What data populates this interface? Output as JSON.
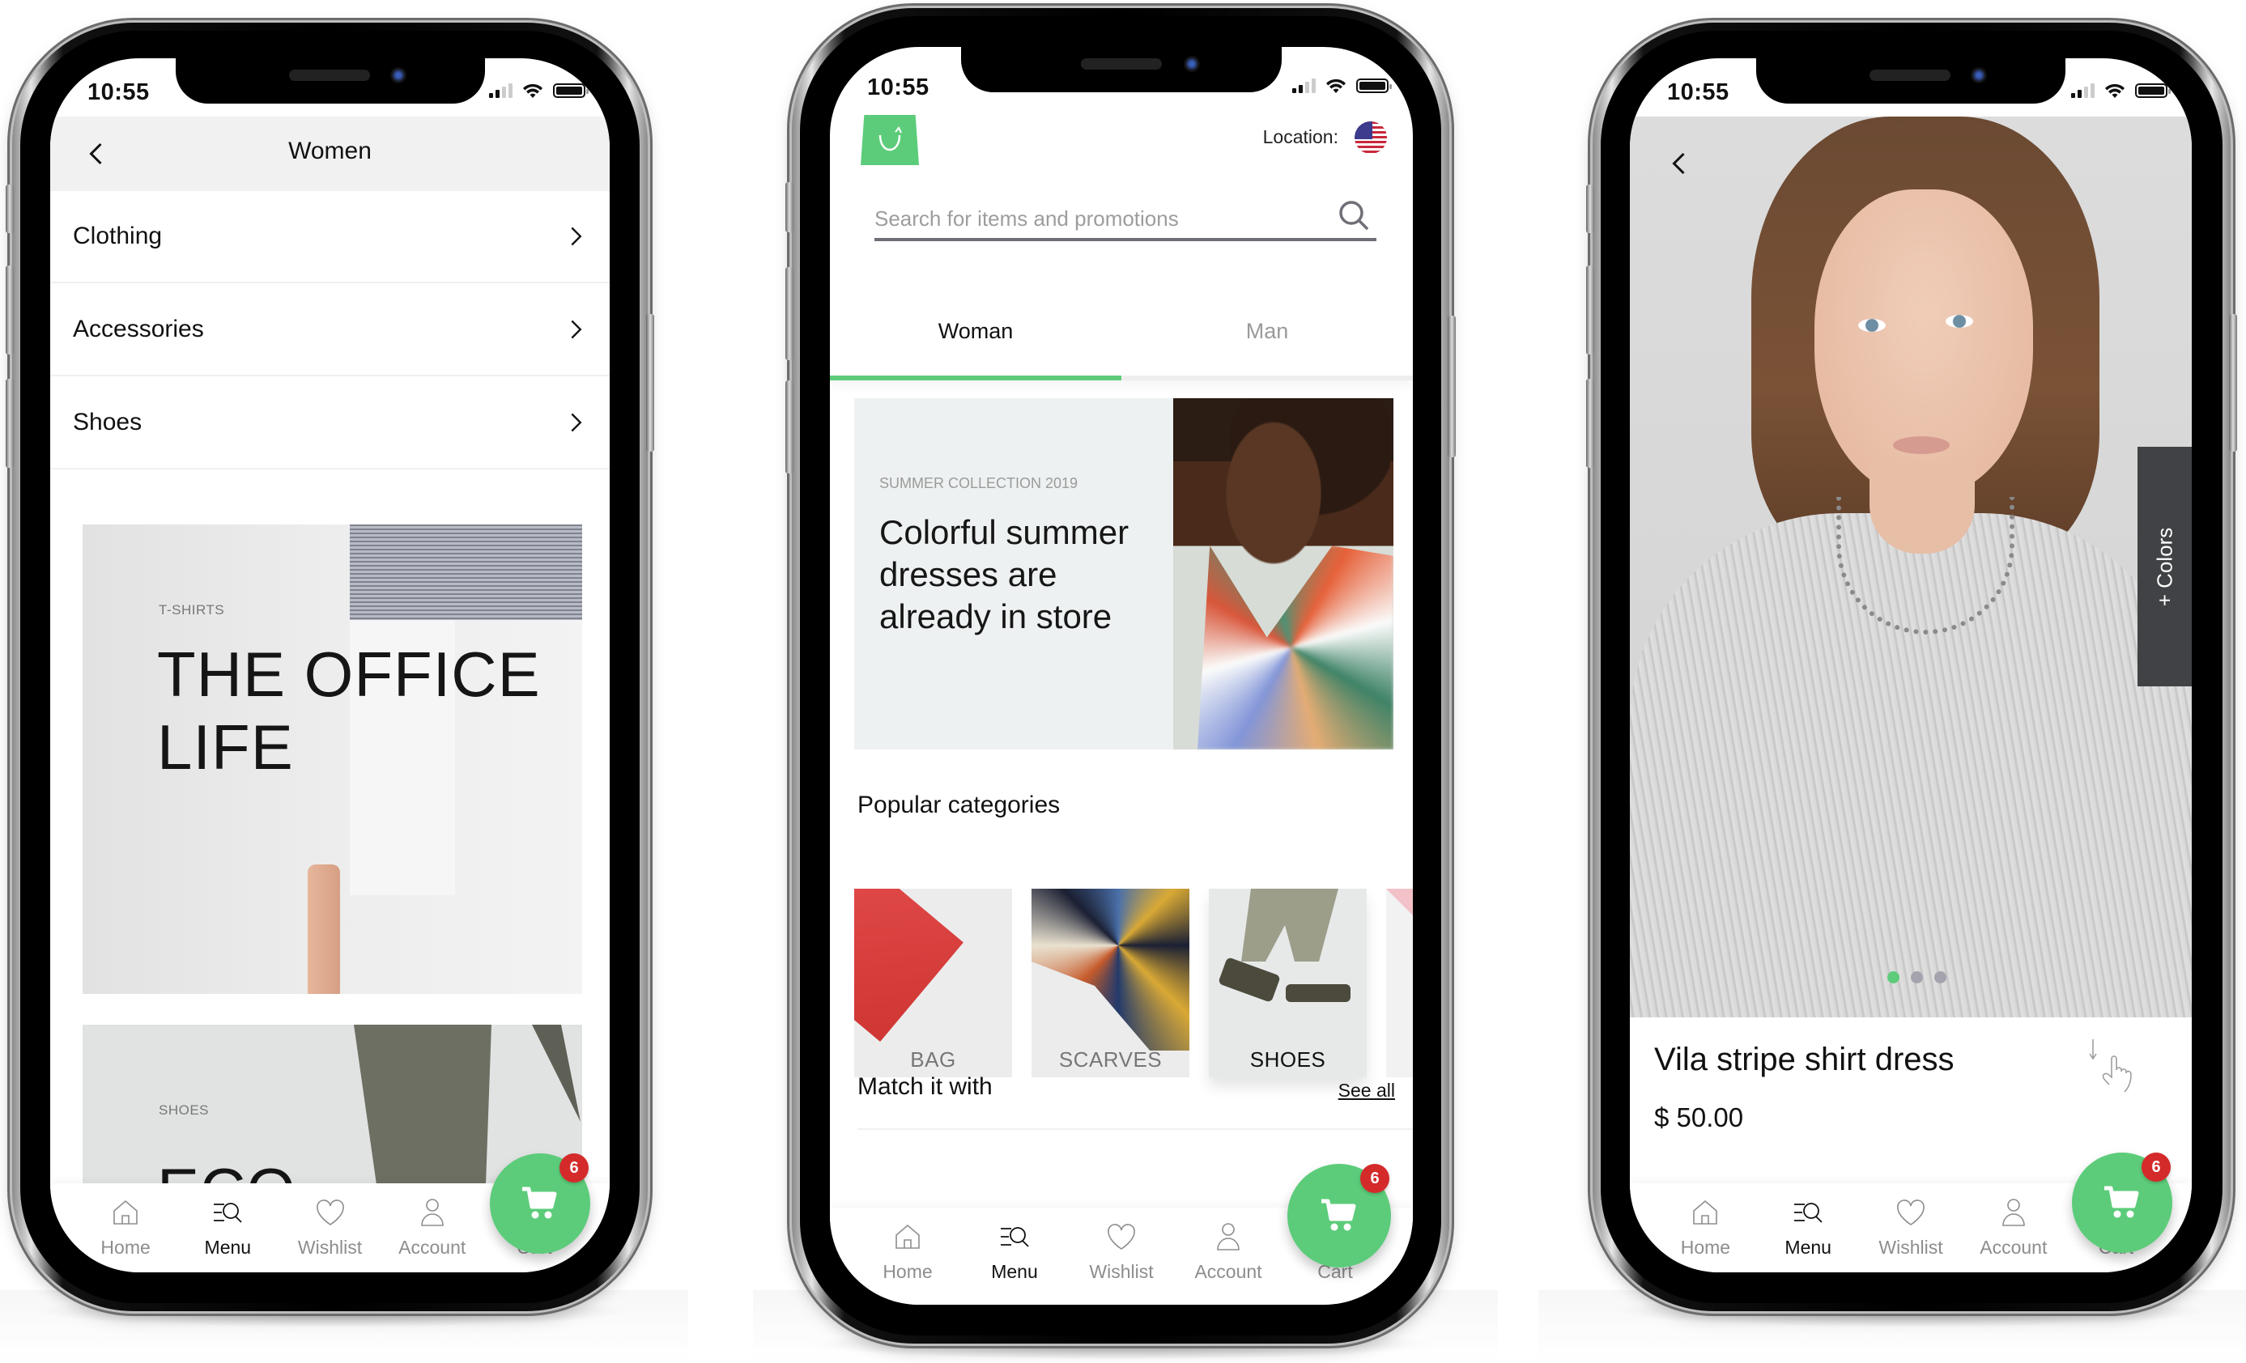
{
  "theme": {
    "accent": "#5ccc7a",
    "badge": "#d42a2a",
    "text": "#111111",
    "muted": "#8d8d8d",
    "colors_tab_bg": "#404245"
  },
  "status_bar": {
    "time": "10:55",
    "icons": [
      "signal-icon",
      "wifi-icon",
      "battery-icon"
    ]
  },
  "tabbar": {
    "items": [
      {
        "label": "Home",
        "icon": "home-icon"
      },
      {
        "label": "Menu",
        "icon": "menu-search-icon",
        "active": true
      },
      {
        "label": "Wishlist",
        "icon": "heart-icon"
      },
      {
        "label": "Account",
        "icon": "user-icon"
      },
      {
        "label": "Cart",
        "icon": "cart-icon"
      }
    ],
    "cart_count": "6"
  },
  "phone1": {
    "header": {
      "title": "Women",
      "back_icon": "chevron-left-icon"
    },
    "menu": [
      {
        "label": "Clothing",
        "icon": "chevron-right-icon"
      },
      {
        "label": "Accessories",
        "icon": "chevron-right-icon"
      },
      {
        "label": "Shoes",
        "icon": "chevron-right-icon"
      }
    ],
    "promos": [
      {
        "kicker": "T-SHIRTS",
        "title_line1": "THE OFFICE",
        "title_line2": "LIFE"
      },
      {
        "kicker": "SHOES",
        "title_line1": "ECO"
      }
    ]
  },
  "phone2": {
    "logo_icon": "shopping-bag-logo-icon",
    "location_label": "Location:",
    "location_flag": "us-flag-icon",
    "search": {
      "placeholder": "Search for items and promotions",
      "value": ""
    },
    "gender_tabs": [
      {
        "label": "Woman",
        "active": true
      },
      {
        "label": "Man",
        "active": false
      }
    ],
    "hero": {
      "kicker": "SUMMER COLLECTION 2019",
      "headline": "Colorful summer dresses are already in store"
    },
    "popular": {
      "title": "Popular categories",
      "items": [
        {
          "label": "BAG"
        },
        {
          "label": "SCARVES"
        },
        {
          "label": "SHOES",
          "active": true
        }
      ]
    },
    "match": {
      "title": "Match it with",
      "see_all": "See all"
    }
  },
  "phone3": {
    "back_icon": "chevron-left-icon",
    "colors_tab": "+ Colors",
    "carousel": {
      "total": 3,
      "active_index": 0
    },
    "product": {
      "name": "Vila stripe shirt dress",
      "price": "$ 50.00"
    },
    "gesture_icon": "swipe-down-hand-icon"
  }
}
